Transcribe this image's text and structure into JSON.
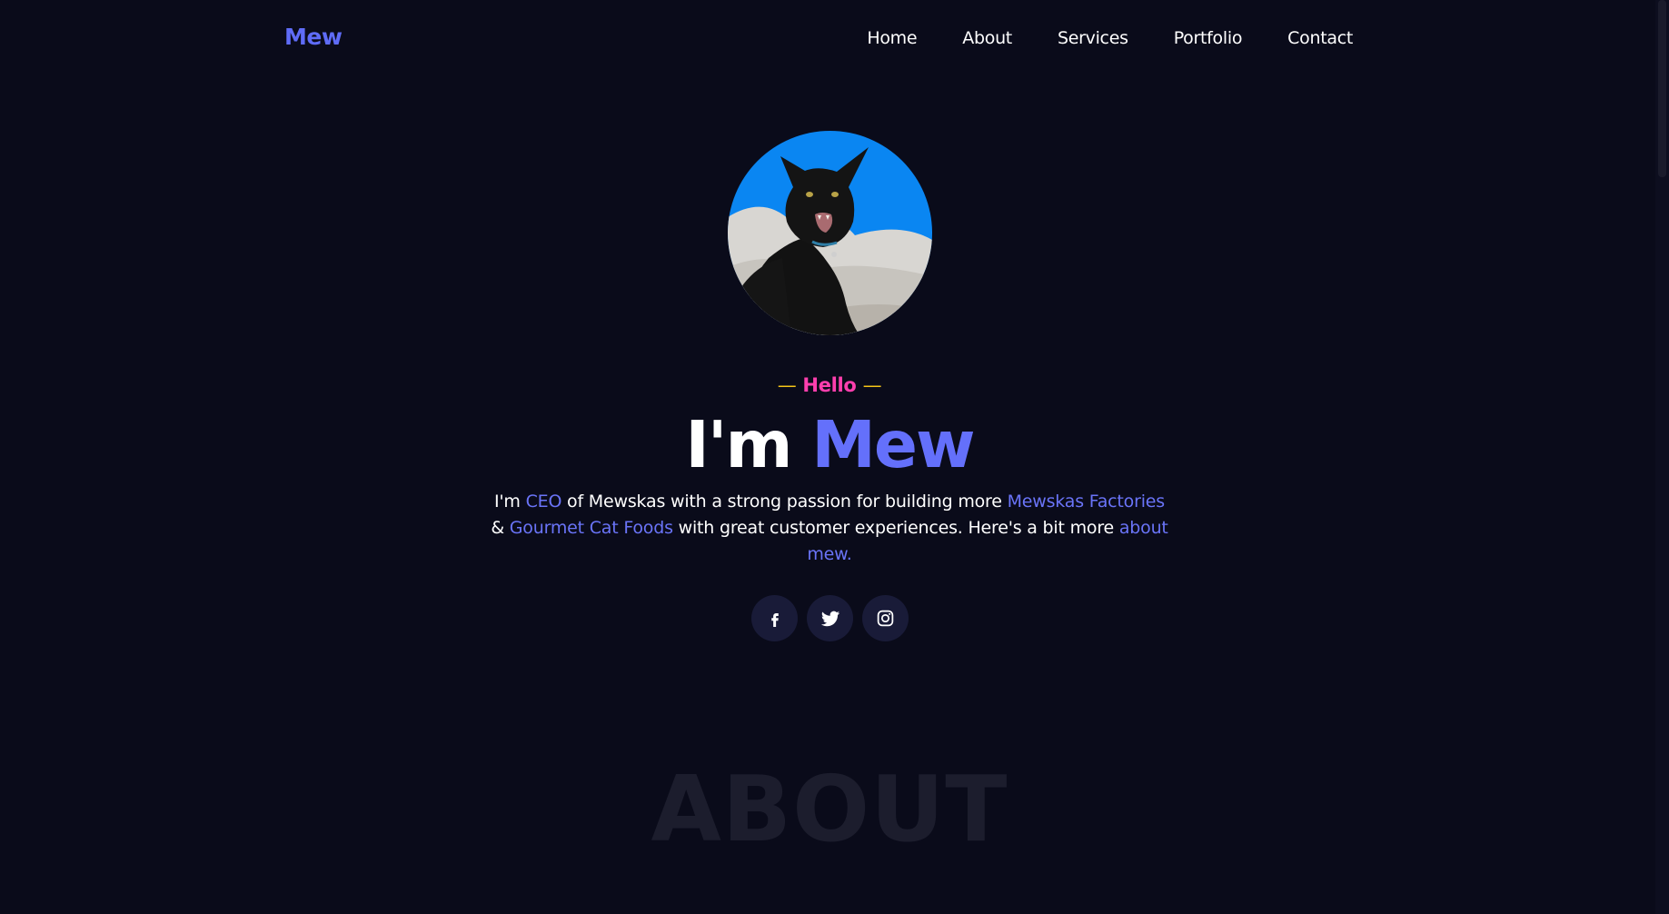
{
  "nav": {
    "logo": "Mew",
    "links": [
      "Home",
      "About",
      "Services",
      "Portfolio",
      "Contact"
    ]
  },
  "hero": {
    "avatar_icon": "cat-photo",
    "greeting": "Hello",
    "greeting_dash": "—",
    "headline_prefix": "I'm",
    "headline_name": "Mew",
    "bio": {
      "p1": "I'm ",
      "link1": "CEO",
      "p2": " of Mewskas with a strong passion for building more ",
      "link2": "Mewskas Factories",
      "p3": " & ",
      "link3": "Gourmet Cat Foods",
      "p4": " with great customer experiences. Here's a bit more ",
      "link4": "about mew."
    },
    "socials": [
      "facebook-icon",
      "twitter-icon",
      "instagram-icon"
    ]
  },
  "about": {
    "bg_title": "ABOUT"
  },
  "colors": {
    "background": "#0a0b1a",
    "accent": "#5f6cf7",
    "pink": "#ff3fae",
    "yellow": "#f5c518"
  }
}
